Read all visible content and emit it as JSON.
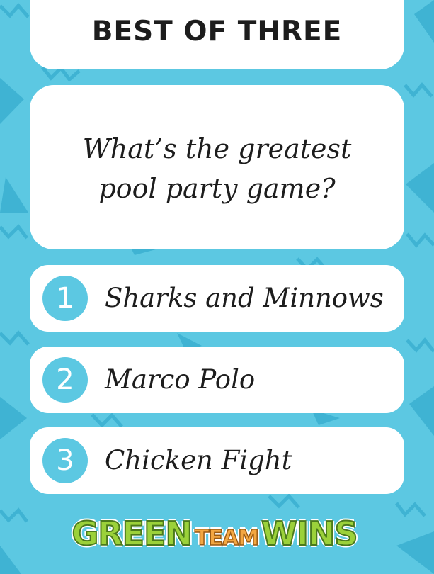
{
  "title": "BEST OF THREE",
  "question": {
    "line1": "What’s the greatest",
    "line2": "pool party game?"
  },
  "options": [
    {
      "number": "1",
      "label": "Sharks and Minnows"
    },
    {
      "number": "2",
      "label": "Marco Polo"
    },
    {
      "number": "3",
      "label": "Chicken Fight"
    }
  ],
  "logo": {
    "word1": "GREEN",
    "word2": "TEAM",
    "word3": "WINS"
  },
  "colors": {
    "background": "#5cc8e2",
    "card": "#ffffff",
    "number_circle": "#5cc8e2",
    "logo_green": "#9bd13a",
    "logo_orange": "#f3a742"
  }
}
